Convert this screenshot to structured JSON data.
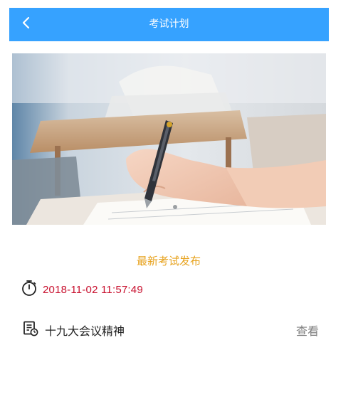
{
  "header": {
    "back_icon": "chevron-left-icon",
    "title": "考试计划",
    "background_color": "#36a2ff"
  },
  "banner": {
    "carousel_total": 1,
    "carousel_active": 1
  },
  "announcement": {
    "heading": "最新考试发布",
    "heading_color": "#e7a21d",
    "timestamp": "2018-11-02 11:57:49",
    "timestamp_color": "#c8102e",
    "clock_icon": "stopwatch-icon"
  },
  "exam_list": [
    {
      "doc_icon": "document-icon",
      "title": "十九大会议精神",
      "action_label": "查看"
    }
  ]
}
